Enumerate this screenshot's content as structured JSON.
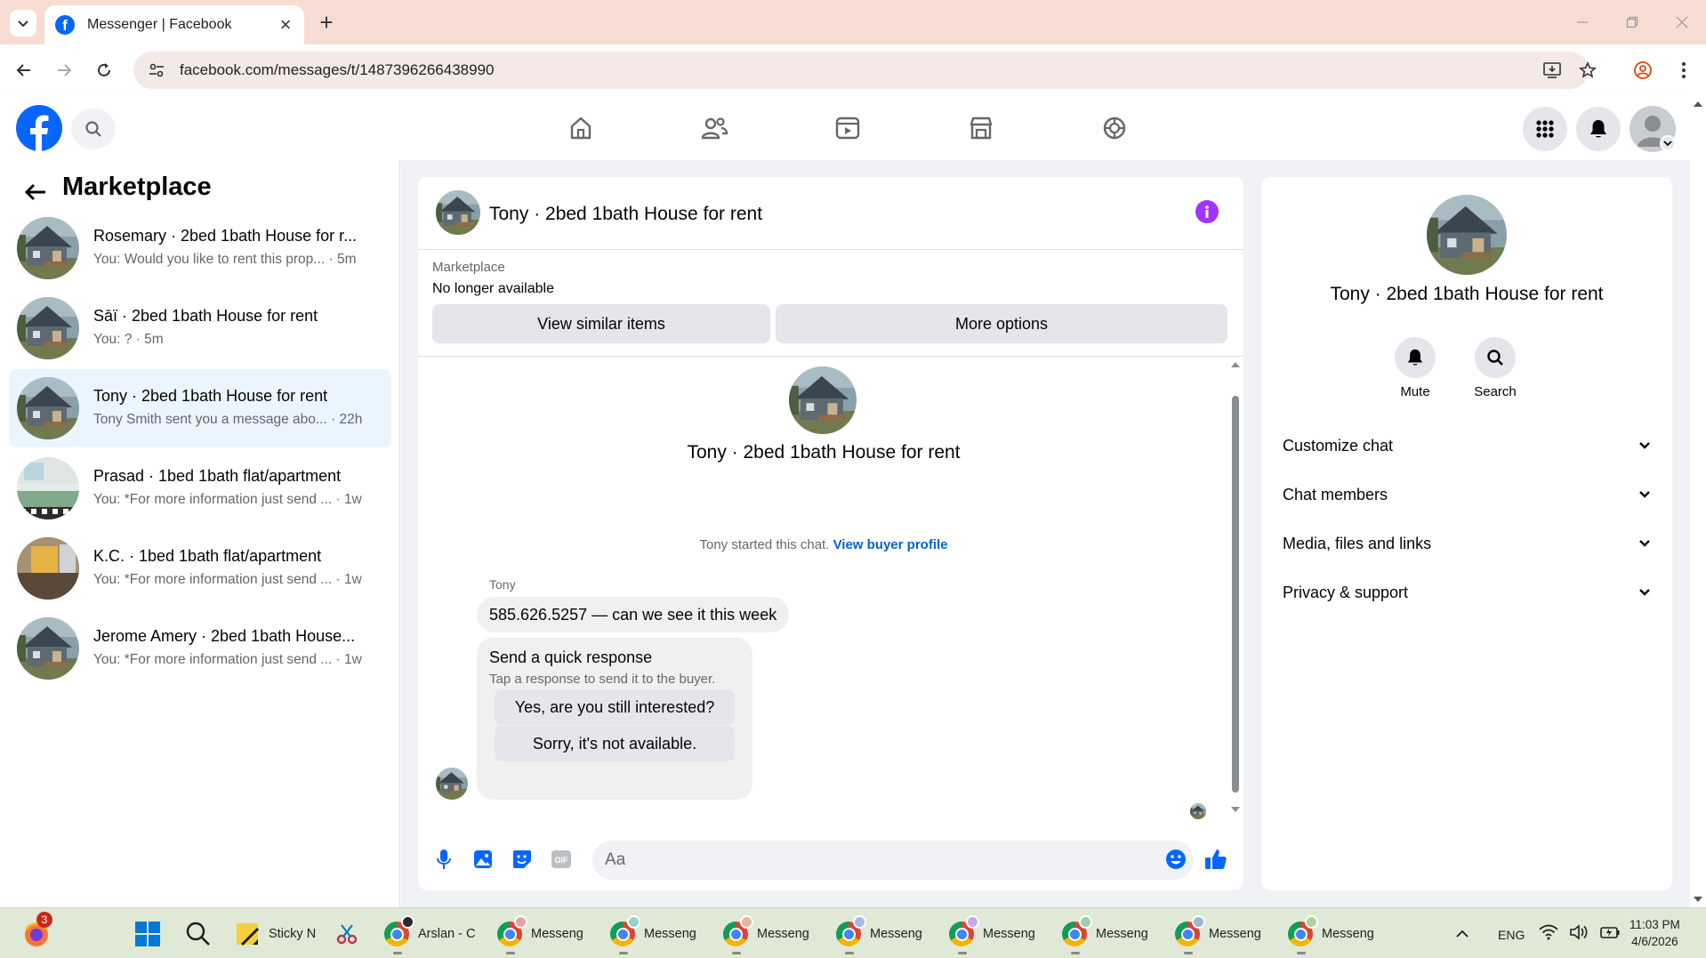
{
  "browser": {
    "tab_title": "Messenger | Facebook",
    "url": "facebook.com/messages/t/1487396266438990"
  },
  "left_panel": {
    "title": "Marketplace",
    "conversations": [
      {
        "name": "Rosemary · 2bed 1bath House for r...",
        "preview": "You: Would you like to rent this prop... · 5m",
        "avatar": "house-thumb"
      },
      {
        "name": "Sāï · 2bed 1bath House for rent",
        "preview": "You: ? · 5m",
        "avatar": "house-thumb"
      },
      {
        "name": "Tony · 2bed 1bath House for rent",
        "preview": "Tony Smith sent you a message abo... · 22h",
        "avatar": "house-thumb",
        "active": true
      },
      {
        "name": "Prasad · 1bed 1bath flat/apartment",
        "preview": "You: *For more information just send ... · 1w",
        "avatar": "kitchen-thumb"
      },
      {
        "name": "K.C. · 1bed 1bath flat/apartment",
        "preview": "You: *For more information just send ... · 1w",
        "avatar": "room-thumb"
      },
      {
        "name": "Jerome Amery · 2bed 1bath House...",
        "preview": "You: *For more information just send ... · 1w",
        "avatar": "house-thumb"
      }
    ]
  },
  "chat": {
    "header_title": "Tony · 2bed 1bath House for rent",
    "marketplace_label": "Marketplace",
    "listing_status": "No longer available",
    "view_similar_label": "View similar items",
    "more_options_label": "More options",
    "center_title": "Tony · 2bed 1bath House for rent",
    "started_text": "Tony started this chat.",
    "buyer_profile_link": "View buyer profile",
    "sender_name": "Tony",
    "message_text": "585.626.5257 — can we see it this week",
    "quick_response": {
      "title": "Send a quick response",
      "subtitle": "Tap a response to send it to the buyer.",
      "options": [
        "Yes, are you still interested?",
        "Sorry, it's not available."
      ]
    },
    "input_placeholder": "Aa"
  },
  "right_panel": {
    "title": "Tony · 2bed 1bath House for rent",
    "actions": [
      {
        "label": "Mute",
        "icon": "bell-icon"
      },
      {
        "label": "Search",
        "icon": "search-icon"
      }
    ],
    "sections": [
      "Customize chat",
      "Chat members",
      "Media, files and links",
      "Privacy & support"
    ]
  },
  "taskbar": {
    "notification_badge": "3",
    "items": [
      "Sticky N",
      "Arslan - C",
      "Messeng",
      "Messeng",
      "Messeng",
      "Messeng",
      "Messeng",
      "Messeng",
      "Messeng",
      "Messeng"
    ],
    "language": "ENG",
    "time": "11:03 PM",
    "date": "4/6/2026"
  },
  "colors": {
    "fb_blue": "#0866ff",
    "active_conversation": "#ebf5ff",
    "info_purple": "#a033ff",
    "link_blue": "#0064d1",
    "taskbar": "#dfe9d5",
    "tab_strip": "#f7dcd4"
  }
}
